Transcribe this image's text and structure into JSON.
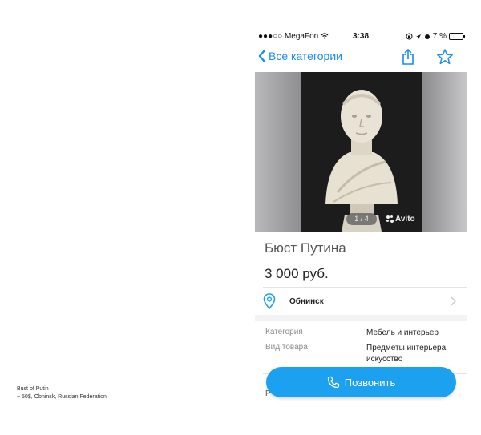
{
  "caption": {
    "line1": "Bust of  Putin",
    "line2": "~ 50$, Obninsk, Russian Federation"
  },
  "status_bar": {
    "carrier": "●●●○○ MegaFon",
    "time": "3:38",
    "battery": "7 %",
    "battery_level": 0.07
  },
  "nav": {
    "back_label": "Все категории",
    "icons": [
      "chevron-left-icon",
      "share-icon",
      "star-icon"
    ]
  },
  "photo": {
    "pager": "1 / 4",
    "watermark": "Avito"
  },
  "listing": {
    "title": "Бюст Путина",
    "price": "3 000 руб.",
    "location": "Обнинск"
  },
  "properties": [
    {
      "label": "Категория",
      "value": "Мебель и интерьер"
    },
    {
      "label": "Вид товара",
      "value": "Предметы интерьера, искусство"
    }
  ],
  "under_button_text": "Р",
  "call_button": {
    "label": "Позвонить"
  },
  "colors": {
    "accent": "#1a8cf2",
    "call_button": "#1ba1ef"
  }
}
